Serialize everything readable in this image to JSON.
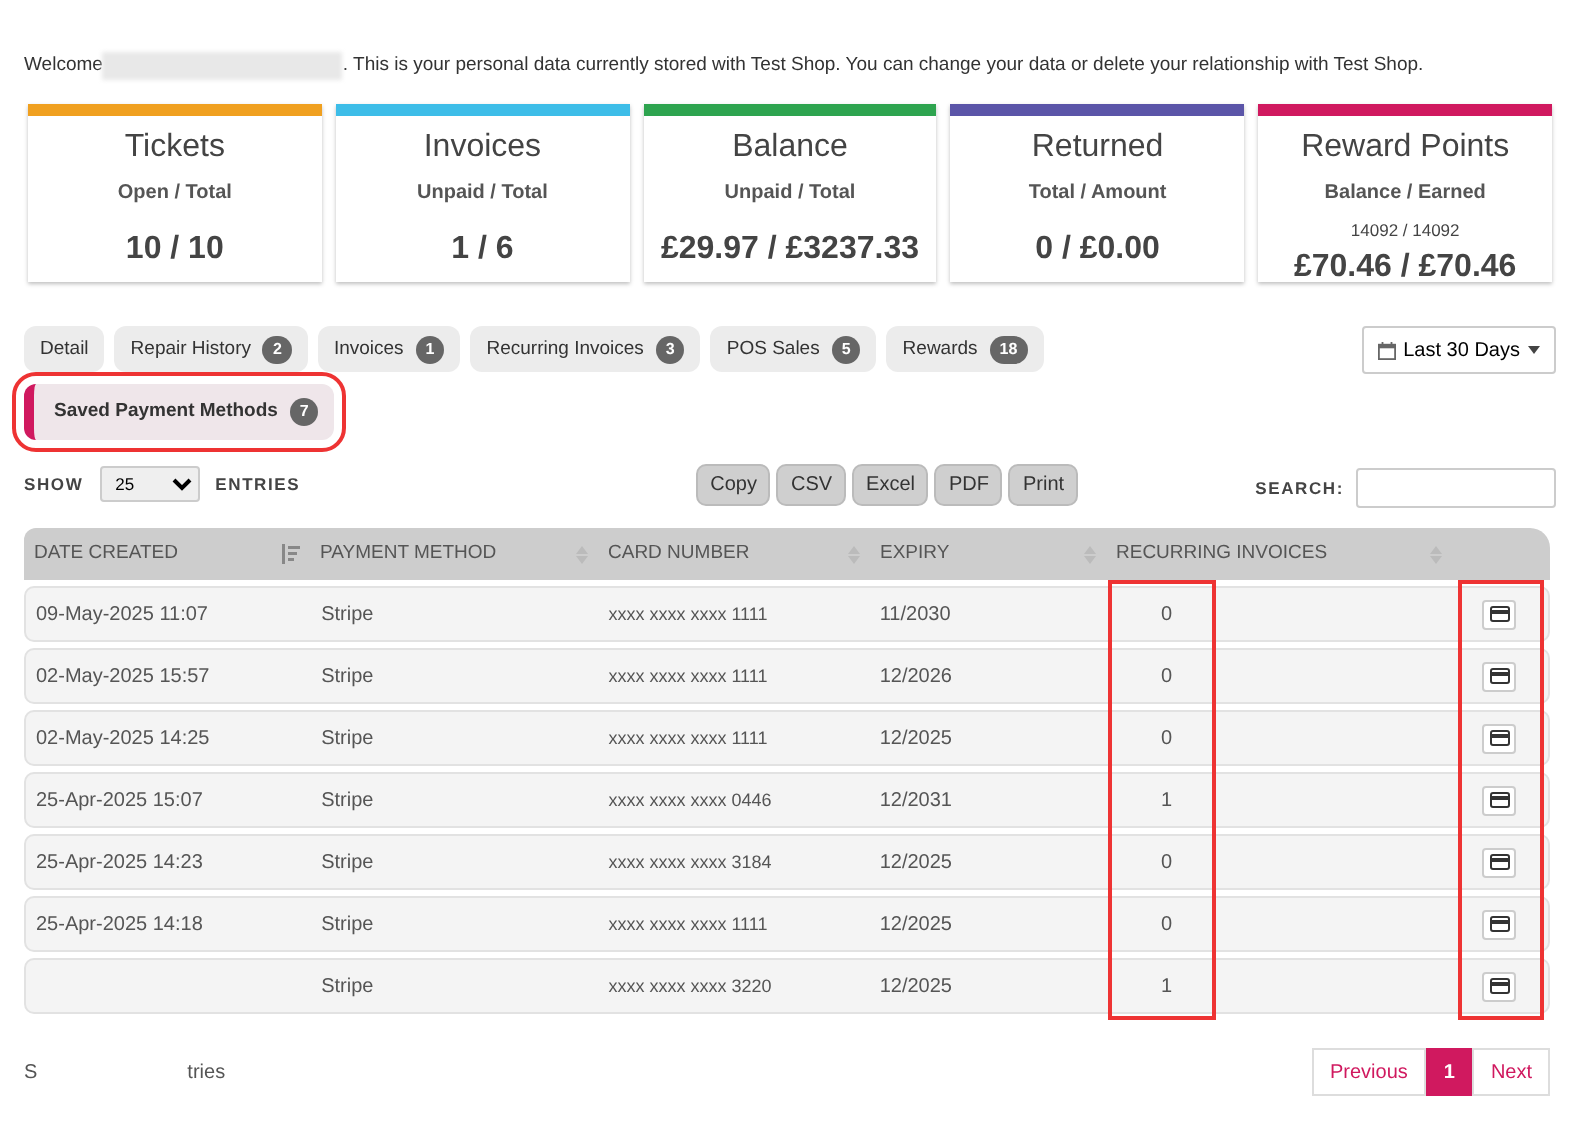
{
  "welcome": {
    "before": "Welcome",
    "name_redacted": true,
    "after": ". This is your personal data currently stored with Test Shop. You can change your data or delete your relationship with Test Shop."
  },
  "stats": [
    {
      "title": "Tickets",
      "subtitle": "Open / Total",
      "value": "10 / 10",
      "color": "#f0a020"
    },
    {
      "title": "Invoices",
      "subtitle": "Unpaid / Total",
      "value": "1 / 6",
      "color": "#3dbde8"
    },
    {
      "title": "Balance",
      "subtitle": "Unpaid / Total",
      "value": "£29.97 / £3237.33",
      "color": "#2ea44f"
    },
    {
      "title": "Returned",
      "subtitle": "Total / Amount",
      "value": "0 / £0.00",
      "color": "#5b55a8"
    },
    {
      "title": "Reward Points",
      "subtitle": "Balance / Earned",
      "note": "14092 / 14092",
      "value": "£70.46 / £70.46",
      "color": "#d0195f"
    }
  ],
  "tabs": [
    {
      "label": "Detail",
      "selected": false,
      "highlighted": false
    },
    {
      "label": "Repair History",
      "badge": "2",
      "selected": false,
      "highlighted": false
    },
    {
      "label": "Invoices",
      "badge": "1",
      "selected": false,
      "highlighted": false
    },
    {
      "label": "Recurring Invoices",
      "badge": "3",
      "selected": false,
      "highlighted": false
    },
    {
      "label": "POS Sales",
      "badge": "5",
      "selected": false,
      "highlighted": false
    },
    {
      "label": "Rewards",
      "badge": "18",
      "selected": false,
      "highlighted": false
    },
    {
      "label": "Saved Payment Methods",
      "badge": "7",
      "selected": true,
      "highlighted": true
    }
  ],
  "date_range": {
    "label": "Last 30 Days"
  },
  "length": {
    "before": "SHOW",
    "value": "25",
    "after": "ENTRIES"
  },
  "export_buttons": [
    "Copy",
    "CSV",
    "Excel",
    "PDF",
    "Print"
  ],
  "search": {
    "label": "SEARCH:"
  },
  "table": {
    "columns": [
      {
        "label": "DATE CREATED",
        "sortable": true,
        "sorted": true,
        "highlighted": false
      },
      {
        "label": "PAYMENT METHOD",
        "sortable": true,
        "sorted": false,
        "highlighted": false
      },
      {
        "label": "CARD NUMBER",
        "sortable": true,
        "sorted": false,
        "highlighted": false
      },
      {
        "label": "EXPIRY",
        "sortable": true,
        "sorted": false,
        "highlighted": false
      },
      {
        "label": "RECURRING INVOICES",
        "sortable": true,
        "sorted": false,
        "highlighted": true
      },
      {
        "highlighted": true
      }
    ],
    "rows": [
      {
        "date": "09-May-2025 11:07",
        "method": "Stripe",
        "card": "xxxx xxxx xxxx 1111",
        "expiry": "11/2030",
        "recurring": "0"
      },
      {
        "date": "02-May-2025 15:57",
        "method": "Stripe",
        "card": "xxxx xxxx xxxx 1111",
        "expiry": "12/2026",
        "recurring": "0"
      },
      {
        "date": "02-May-2025 14:25",
        "method": "Stripe",
        "card": "xxxx xxxx xxxx 1111",
        "expiry": "12/2025",
        "recurring": "0"
      },
      {
        "date": "25-Apr-2025 15:07",
        "method": "Stripe",
        "card": "xxxx xxxx xxxx 0446",
        "expiry": "12/2031",
        "recurring": "1"
      },
      {
        "date": "25-Apr-2025 14:23",
        "method": "Stripe",
        "card": "xxxx xxxx xxxx 3184",
        "expiry": "12/2025",
        "recurring": "0"
      },
      {
        "date": "25-Apr-2025 14:18",
        "method": "Stripe",
        "card": "xxxx xxxx xxxx 1111",
        "expiry": "12/2025",
        "recurring": "0"
      },
      {
        "method": "Stripe",
        "card": "xxxx xxxx xxxx 3220",
        "expiry": "12/2025",
        "recurring": "1"
      }
    ]
  },
  "info": [
    "S",
    "tries"
  ],
  "pagination": [
    {
      "label": "Previous",
      "selected": false
    },
    {
      "label": "1",
      "selected": true
    },
    {
      "label": "Next",
      "selected": false
    }
  ]
}
